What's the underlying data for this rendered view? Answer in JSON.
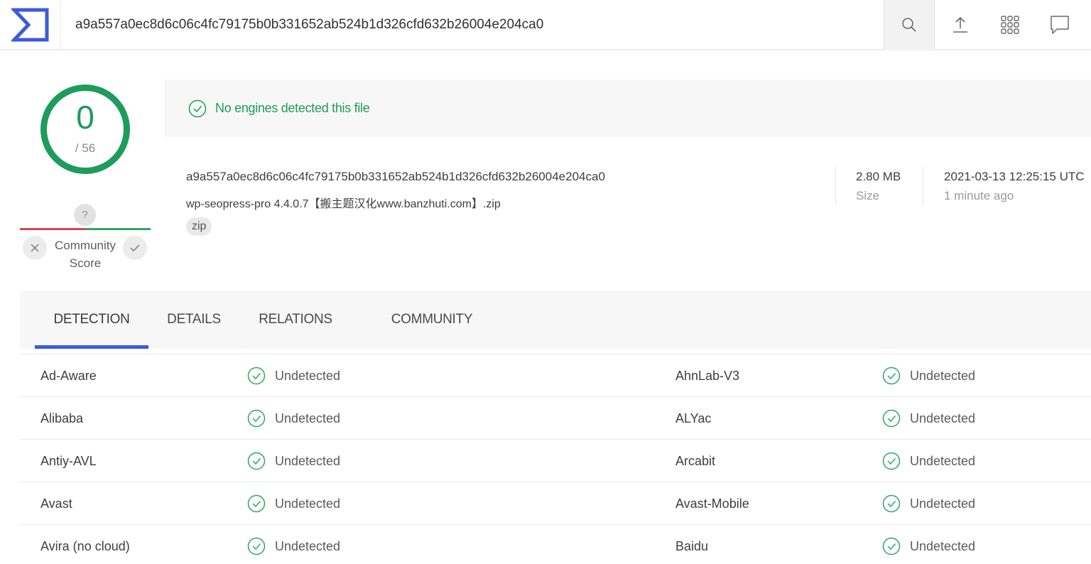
{
  "header": {
    "search_value": "a9a557a0ec8d6c06c4fc79175b0b331652ab524b1d326cfd632b26004e204ca0",
    "icons": [
      "virustotal-logo",
      "search-icon",
      "upload-icon",
      "apps-grid-icon",
      "chat-icon"
    ]
  },
  "score": {
    "detections": "0",
    "total": "/ 56",
    "community_q": "?",
    "community_label_1": "Community",
    "community_label_2": "Score",
    "accent_green": "#1d9c5b",
    "accent_red": "#d1475a"
  },
  "banner": {
    "text": "No engines detected this file"
  },
  "file": {
    "hash": "a9a557a0ec8d6c06c4fc79175b0b331652ab524b1d326cfd632b26004e204ca0",
    "name": "wp-seopress-pro 4.4.0.7【搬主题汉化www.banzhuti.com】.zip",
    "tag": "zip",
    "size_value": "2.80 MB",
    "size_label": "Size",
    "date_value": "2021-03-13 12:25:15 UTC",
    "date_label": "1 minute ago"
  },
  "tabs": [
    "DETECTION",
    "DETAILS",
    "RELATIONS",
    "COMMUNITY"
  ],
  "active_tab": "DETECTION",
  "detections": [
    {
      "left_engine": "Ad-Aware",
      "left_result": "Undetected",
      "right_engine": "AhnLab-V3",
      "right_result": "Undetected"
    },
    {
      "left_engine": "Alibaba",
      "left_result": "Undetected",
      "right_engine": "ALYac",
      "right_result": "Undetected"
    },
    {
      "left_engine": "Antiy-AVL",
      "left_result": "Undetected",
      "right_engine": "Arcabit",
      "right_result": "Undetected"
    },
    {
      "left_engine": "Avast",
      "left_result": "Undetected",
      "right_engine": "Avast-Mobile",
      "right_result": "Undetected"
    },
    {
      "left_engine": "Avira (no cloud)",
      "left_result": "Undetected",
      "right_engine": "Baidu",
      "right_result": "Undetected"
    }
  ]
}
